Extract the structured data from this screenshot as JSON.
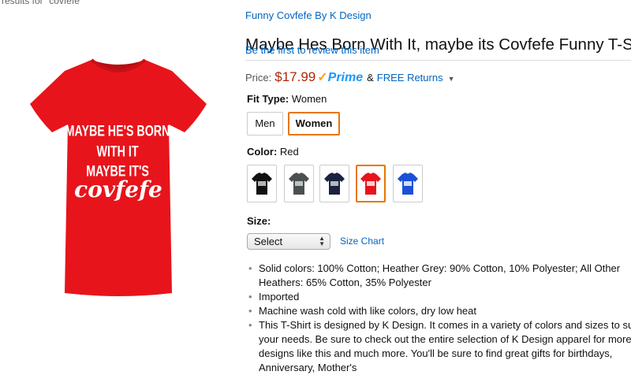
{
  "search": {
    "results_text": "results for \"covfefe\""
  },
  "product": {
    "brand": "Funny Covfefe By K Design",
    "title": "Maybe Hes Born With It, maybe its Covfefe Funny T-Shirt",
    "review_link": "Be the first to review this item",
    "shirt_text": {
      "line1": "MAYBE HE'S BORN",
      "line2": "WITH IT",
      "line3": "MAYBE IT'S",
      "line4": "covfefe"
    },
    "shirt_color": "#e8141b"
  },
  "price": {
    "label": "Price:",
    "value": "$17.99",
    "prime_check": "✓",
    "prime_label": "Prime",
    "amp": "&",
    "free_returns": "FREE Returns",
    "caret": "▼"
  },
  "fit": {
    "label": "Fit Type:",
    "selected": "Women",
    "options": [
      "Men",
      "Women"
    ]
  },
  "color": {
    "label": "Color:",
    "selected": "Red",
    "swatches": [
      {
        "name": "black",
        "hex": "#111111"
      },
      {
        "name": "heather-grey",
        "hex": "#4a4f52"
      },
      {
        "name": "navy",
        "hex": "#1a2240"
      },
      {
        "name": "red",
        "hex": "#e8141b"
      },
      {
        "name": "royal-blue",
        "hex": "#1b4fd6"
      }
    ],
    "selected_index": 3
  },
  "size": {
    "label": "Size:",
    "select_value": "Select",
    "chart_link": "Size Chart"
  },
  "bullets": [
    "Solid colors: 100% Cotton; Heather Grey: 90% Cotton, 10% Polyester; All Other Heathers: 65% Cotton, 35% Polyester",
    "Imported",
    "Machine wash cold with like colors, dry low heat",
    "This T-Shirt is designed by K Design. It comes in a variety of colors and sizes to suit your needs. Be sure to check out the entire selection of K Design apparel for more designs like this and much more. You'll be sure to find great gifts for birthdays, Anniversary, Mother's"
  ],
  "colors": {
    "link": "#0066c0",
    "price": "#b12704",
    "selected_border": "#e77600",
    "prime": "#1a98ff"
  }
}
